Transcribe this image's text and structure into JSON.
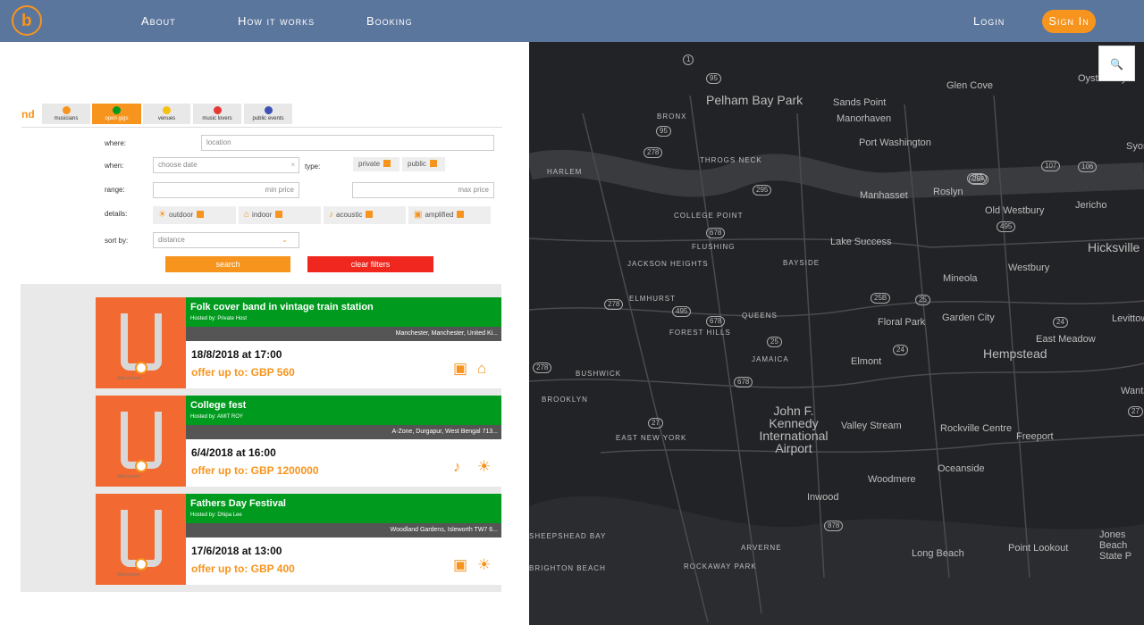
{
  "nav": {
    "logo_letter": "b",
    "about": "About",
    "how_it_works": "How it works",
    "booking": "Booking",
    "login": "Login",
    "signin": "Sign In"
  },
  "category_tabs": {
    "prefix": "nd",
    "items": [
      {
        "label": "musicians",
        "color": "#f7941d"
      },
      {
        "label": "open gigs",
        "color": "#009b1e"
      },
      {
        "label": "venues",
        "color": "#f4c20d"
      },
      {
        "label": "music lovers",
        "color": "#e53935"
      },
      {
        "label": "public events",
        "color": "#3f51b5"
      }
    ]
  },
  "filters": {
    "where_label": "where:",
    "location_placeholder": "location",
    "when_label": "when:",
    "date_placeholder": "choose date",
    "type_label": "type:",
    "private_label": "private",
    "public_label": "public",
    "range_label": "range:",
    "min_price_placeholder": "min price",
    "max_price_placeholder": "max price",
    "details_label": "details:",
    "outdoor_label": "outdoor",
    "indoor_label": "indoor",
    "acoustic_label": "acoustic",
    "amplified_label": "amplified",
    "sort_label": "sort by:",
    "sort_value": "distance",
    "search_button": "search",
    "clear_button": "clear filters"
  },
  "results": [
    {
      "title": "Folk cover band in vintage train station",
      "host": "Hosted by: Private Host",
      "location": "Manchester, Manchester, United Ki...",
      "date": "18/8/2018 at 17:00",
      "offer": "offer up to: GBP 560",
      "img_caption": "little concert",
      "icons": [
        "speaker-icon",
        "house-icon"
      ]
    },
    {
      "title": "College fest",
      "host": "Hosted by: AMIT ROY",
      "location": "A-Zone, Durgapur, West Bengal 713...",
      "date": "6/4/2018 at 16:00",
      "offer": "offer up to: GBP 1200000",
      "img_caption": "littleconcert",
      "icons": [
        "guitar-icon",
        "sun-icon"
      ]
    },
    {
      "title": "Fathers Day Festival",
      "host": "Hosted by: Dhipa Lee",
      "location": "Woodland Gardens, Isleworth TW7 6...",
      "date": "17/6/2018 at 13:00",
      "offer": "offer up to: GBP 400",
      "img_caption": "littleconcert",
      "icons": [
        "speaker-icon",
        "sun-icon"
      ]
    }
  ],
  "map": {
    "labels": [
      {
        "text": "Pelham Bay Park",
        "cls": "big"
      },
      {
        "text": "Sands Point"
      },
      {
        "text": "Manorhaven"
      },
      {
        "text": "Glen Cove"
      },
      {
        "text": "Port Washington"
      },
      {
        "text": "Manhasset"
      },
      {
        "text": "Roslyn"
      },
      {
        "text": "Old Westbury"
      },
      {
        "text": "Jericho"
      },
      {
        "text": "Hicksville",
        "cls": "big"
      },
      {
        "text": "Westbury"
      },
      {
        "text": "Lake Success"
      },
      {
        "text": "Mineola"
      },
      {
        "text": "Garden City"
      },
      {
        "text": "Levittown"
      },
      {
        "text": "East Meadow"
      },
      {
        "text": "Hempstead",
        "cls": "big"
      },
      {
        "text": "Floral Park"
      },
      {
        "text": "Elmont"
      },
      {
        "text": "QUEENS",
        "cls": "small"
      },
      {
        "text": "BROOKLYN",
        "cls": "small"
      },
      {
        "text": "John F. Kennedy International Airport",
        "cls": "big"
      },
      {
        "text": "Valley Stream"
      },
      {
        "text": "Rockville Centre"
      },
      {
        "text": "Freeport"
      },
      {
        "text": "Oceanside"
      },
      {
        "text": "Woodmere"
      },
      {
        "text": "Inwood"
      },
      {
        "text": "Long Beach"
      },
      {
        "text": "Point Lookout"
      },
      {
        "text": "Jones Beach State P"
      },
      {
        "text": "JACKSON HEIGHTS",
        "cls": "small"
      },
      {
        "text": "ELMHURST",
        "cls": "small"
      },
      {
        "text": "FOREST HILLS",
        "cls": "small"
      },
      {
        "text": "JAMAICA",
        "cls": "small"
      },
      {
        "text": "BUSHWICK",
        "cls": "small"
      },
      {
        "text": "FLUSHING",
        "cls": "small"
      },
      {
        "text": "COLLEGE POINT",
        "cls": "small"
      },
      {
        "text": "BAYSIDE",
        "cls": "small"
      },
      {
        "text": "EAST NEW YORK",
        "cls": "small"
      },
      {
        "text": "ARVERNE",
        "cls": "small"
      },
      {
        "text": "ROCKAWAY PARK",
        "cls": "small"
      },
      {
        "text": "BRONX",
        "cls": "small"
      },
      {
        "text": "THROGS NECK",
        "cls": "small"
      },
      {
        "text": "HARLEM",
        "cls": "small"
      },
      {
        "text": "SHEEPSHEAD BAY",
        "cls": "small"
      },
      {
        "text": "BRIGHTON BEACH",
        "cls": "small"
      },
      {
        "text": "Wantag"
      },
      {
        "text": "Syosset"
      },
      {
        "text": "Oyster Bay"
      }
    ],
    "shields": [
      "1",
      "95",
      "95",
      "278",
      "295",
      "678",
      "25A",
      "107",
      "106",
      "25A",
      "495",
      "25B",
      "25",
      "678",
      "24",
      "24",
      "25",
      "27",
      "678",
      "878",
      "27",
      "495",
      "278",
      "278"
    ],
    "search_icon_label": "search-icon"
  }
}
